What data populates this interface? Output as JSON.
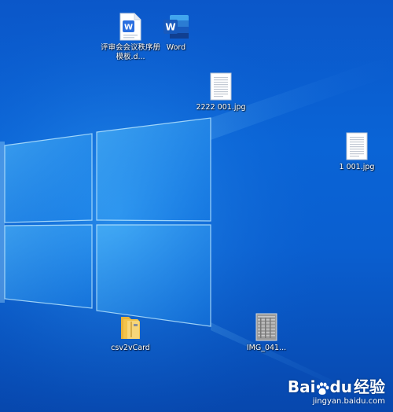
{
  "desktop": {
    "icons": [
      {
        "name": "wps-doc-icon",
        "label": "评审会会议秩序册模板.d..."
      },
      {
        "name": "word-app-icon",
        "label": "Word"
      },
      {
        "name": "jpg-file-icon",
        "label": "2222 001.jpg"
      },
      {
        "name": "jpg-file-icon",
        "label": "1 001.jpg"
      },
      {
        "name": "folder-icon",
        "label": "csv2vCard"
      },
      {
        "name": "image-file-icon",
        "label": "IMG_041..."
      }
    ]
  },
  "watermark": {
    "brand": "Bai",
    "brand_tail": "du",
    "cn": "经验",
    "url": "jingyan.baidu.com"
  },
  "colors": {
    "wallpaper_dark": "#0747ad",
    "wallpaper_mid": "#0a64d6",
    "word_blue": "#185abd",
    "wps_blue": "#2b6fe0",
    "folder_yellow": "#f3c34a"
  }
}
